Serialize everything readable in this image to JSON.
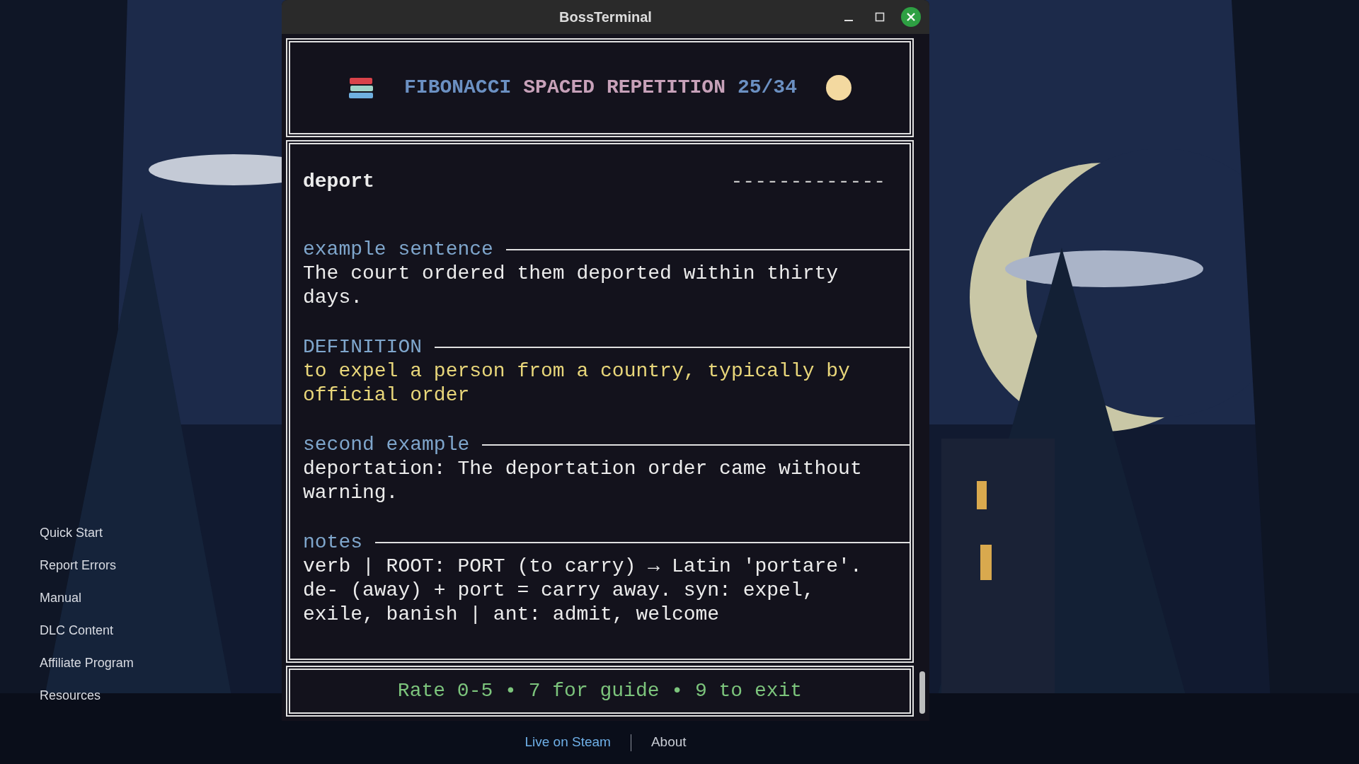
{
  "window": {
    "title": "BossTerminal"
  },
  "header": {
    "parts": [
      {
        "text": "FIBONACCI",
        "color": "#6b90c2"
      },
      {
        "text": "SPACED REPETITION",
        "color": "#c7a1b9"
      },
      {
        "text": "25/34",
        "color": "#6b90c2"
      }
    ]
  },
  "card": {
    "word": "deport",
    "answer_mask": "-------------",
    "sections": [
      {
        "label": "example sentence",
        "text": "The court ordered them deported within thirty days.",
        "kind": "plain"
      },
      {
        "label": "DEFINITION",
        "text": "to expel a person from a country, typically by official order",
        "kind": "definition"
      },
      {
        "label": "second example",
        "text": "deportation: The deportation order came without warning.",
        "kind": "plain"
      },
      {
        "label": "notes",
        "text": "verb | ROOT: PORT (to carry) → Latin 'portare'. de- (away) + port = carry away. syn: expel, exile, banish | ant: admit, welcome",
        "kind": "plain"
      }
    ]
  },
  "footer": "Rate 0-5 • 7 for guide • 9 to exit",
  "sidebar": {
    "items": [
      "Quick Start",
      "Report Errors",
      "Manual",
      "DLC Content",
      "Affiliate Program",
      "Resources"
    ]
  },
  "bottom_links": [
    {
      "label": "Live on Steam",
      "kind": "accent"
    },
    {
      "label": "About",
      "kind": "plain"
    }
  ]
}
